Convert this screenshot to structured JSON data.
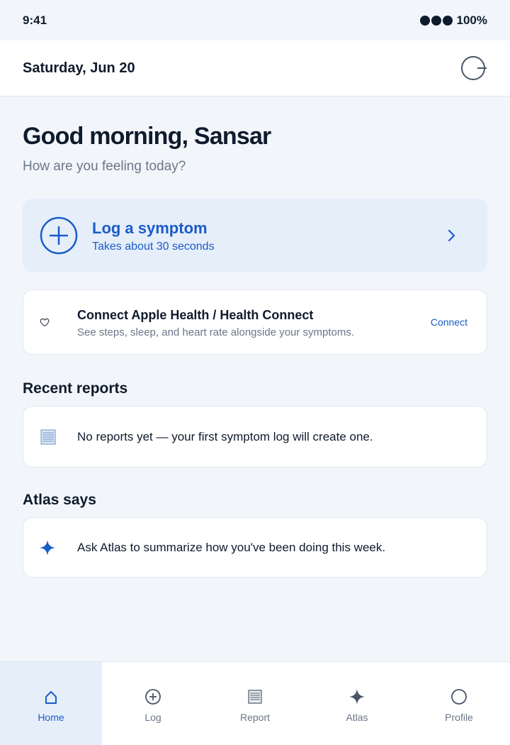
{
  "status_bar": {
    "time": "9:41",
    "battery": "100%"
  },
  "header": {
    "date": "Saturday, Jun 20",
    "menu_icon": "circle-line-icon"
  },
  "greeting": {
    "title": "Good morning, Sansar",
    "subtitle": "How are you feeling today?"
  },
  "log_card": {
    "title": "Log a symptom",
    "subtitle": "Takes about 30 seconds",
    "icon": "plus-circle-icon"
  },
  "connect_card": {
    "title": "Connect Apple Health / Health Connect",
    "subtitle": "See steps, sleep, and heart rate alongside your symptoms.",
    "action": "Connect",
    "icon": "heart-icon"
  },
  "recent_reports": {
    "title": "Recent reports",
    "empty_text": "No reports yet — your first symptom log will create one.",
    "icon": "document-icon"
  },
  "atlas": {
    "title": "Atlas says",
    "text": "Ask Atlas to summarize how you've been doing this week.",
    "icon": "sparkle-icon"
  },
  "tabs": [
    {
      "label": "Home",
      "icon": "home-icon",
      "active": true
    },
    {
      "label": "Log",
      "icon": "plus-circle-icon",
      "active": false
    },
    {
      "label": "Report",
      "icon": "document-icon",
      "active": false
    },
    {
      "label": "Atlas",
      "icon": "sparkle-icon",
      "active": false
    },
    {
      "label": "Profile",
      "icon": "circle-icon",
      "active": false
    }
  ],
  "colors": {
    "accent": "#1a5cc8",
    "background": "#f2f6fa",
    "card_tint": "#e6eefa",
    "text": "#0f1b2d",
    "muted": "#6b7688"
  }
}
